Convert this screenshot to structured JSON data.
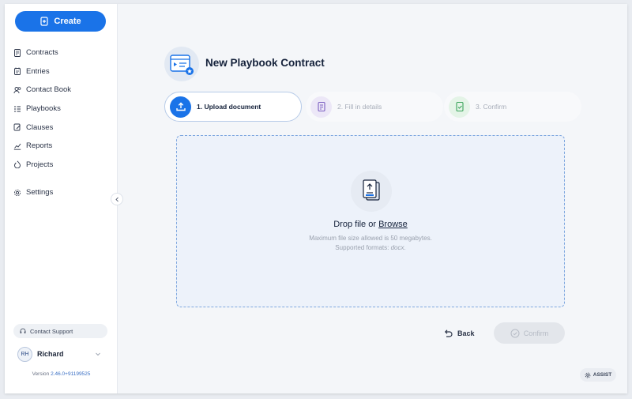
{
  "sidebar": {
    "create_label": "Create",
    "items": [
      {
        "label": "Contracts",
        "icon": "contract-icon"
      },
      {
        "label": "Entries",
        "icon": "entries-icon"
      },
      {
        "label": "Contact Book",
        "icon": "contact-book-icon"
      },
      {
        "label": "Playbooks",
        "icon": "playbooks-icon"
      },
      {
        "label": "Clauses",
        "icon": "clauses-icon"
      },
      {
        "label": "Reports",
        "icon": "reports-icon"
      },
      {
        "label": "Projects",
        "icon": "projects-icon"
      },
      {
        "label": "Settings",
        "icon": "gear-icon"
      }
    ],
    "support_label": "Contact Support",
    "user": {
      "initials": "RH",
      "name": "Richard"
    },
    "version_prefix": "Version",
    "version_number": "2.46.0+91199525"
  },
  "header": {
    "title": "New Playbook Contract"
  },
  "steps": [
    {
      "label": "1. Upload document",
      "state": "active"
    },
    {
      "label": "2. Fill in details",
      "state": "inactive"
    },
    {
      "label": "3. Confirm",
      "state": "inactive"
    }
  ],
  "dropzone": {
    "text_prefix": "Drop file or",
    "browse_label": "Browse",
    "max_size": "Maximum file size allowed is 50 megabytes.",
    "formats_prefix": "Supported formats:",
    "formats_value": "docx."
  },
  "actions": {
    "back_label": "Back",
    "confirm_label": "Confirm"
  },
  "assist_label": "ASSIST",
  "colors": {
    "accent": "#1a73e8",
    "sidebar_bg": "#ffffff",
    "main_bg": "#f4f6f9",
    "dropzone_border": "#7ea7df"
  }
}
